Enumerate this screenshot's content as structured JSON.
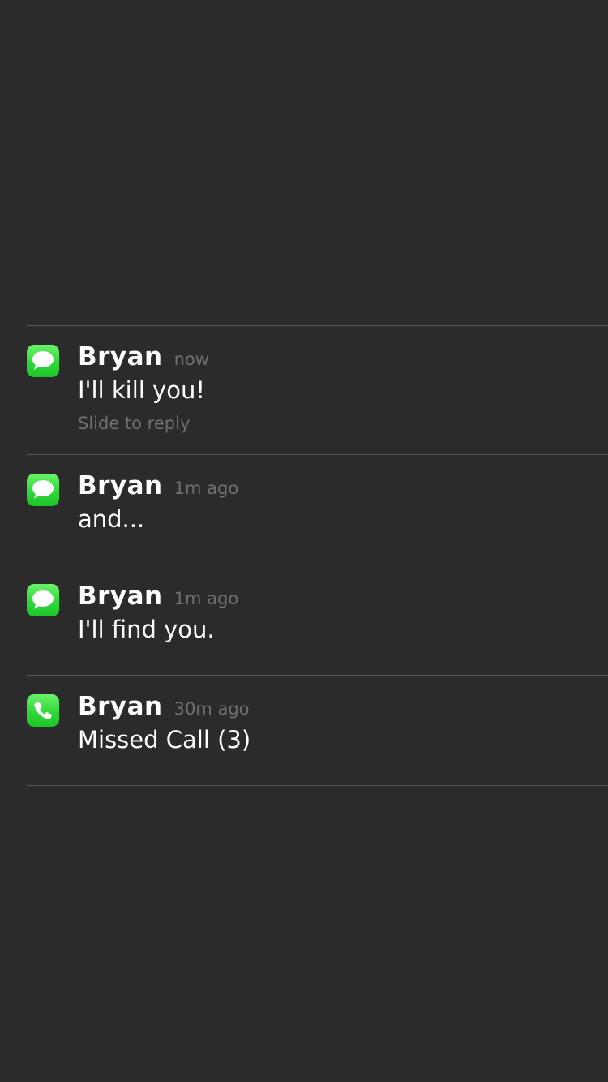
{
  "notifications": [
    {
      "app_icon": "messages-icon",
      "sender": "Bryan",
      "time": "now",
      "message": "I'll kill you!",
      "action_hint": "Slide to reply"
    },
    {
      "app_icon": "messages-icon",
      "sender": "Bryan",
      "time": "1m ago",
      "message": "and..."
    },
    {
      "app_icon": "messages-icon",
      "sender": "Bryan",
      "time": "1m ago",
      "message": "I'll find you."
    },
    {
      "app_icon": "phone-icon",
      "sender": "Bryan",
      "time": "30m ago",
      "message": "Missed Call (3)"
    }
  ],
  "colors": {
    "background": "#2b2b2b",
    "divider": "#5a5a5a",
    "icon_green": "#2fd83a",
    "secondary_text": "#707070"
  }
}
